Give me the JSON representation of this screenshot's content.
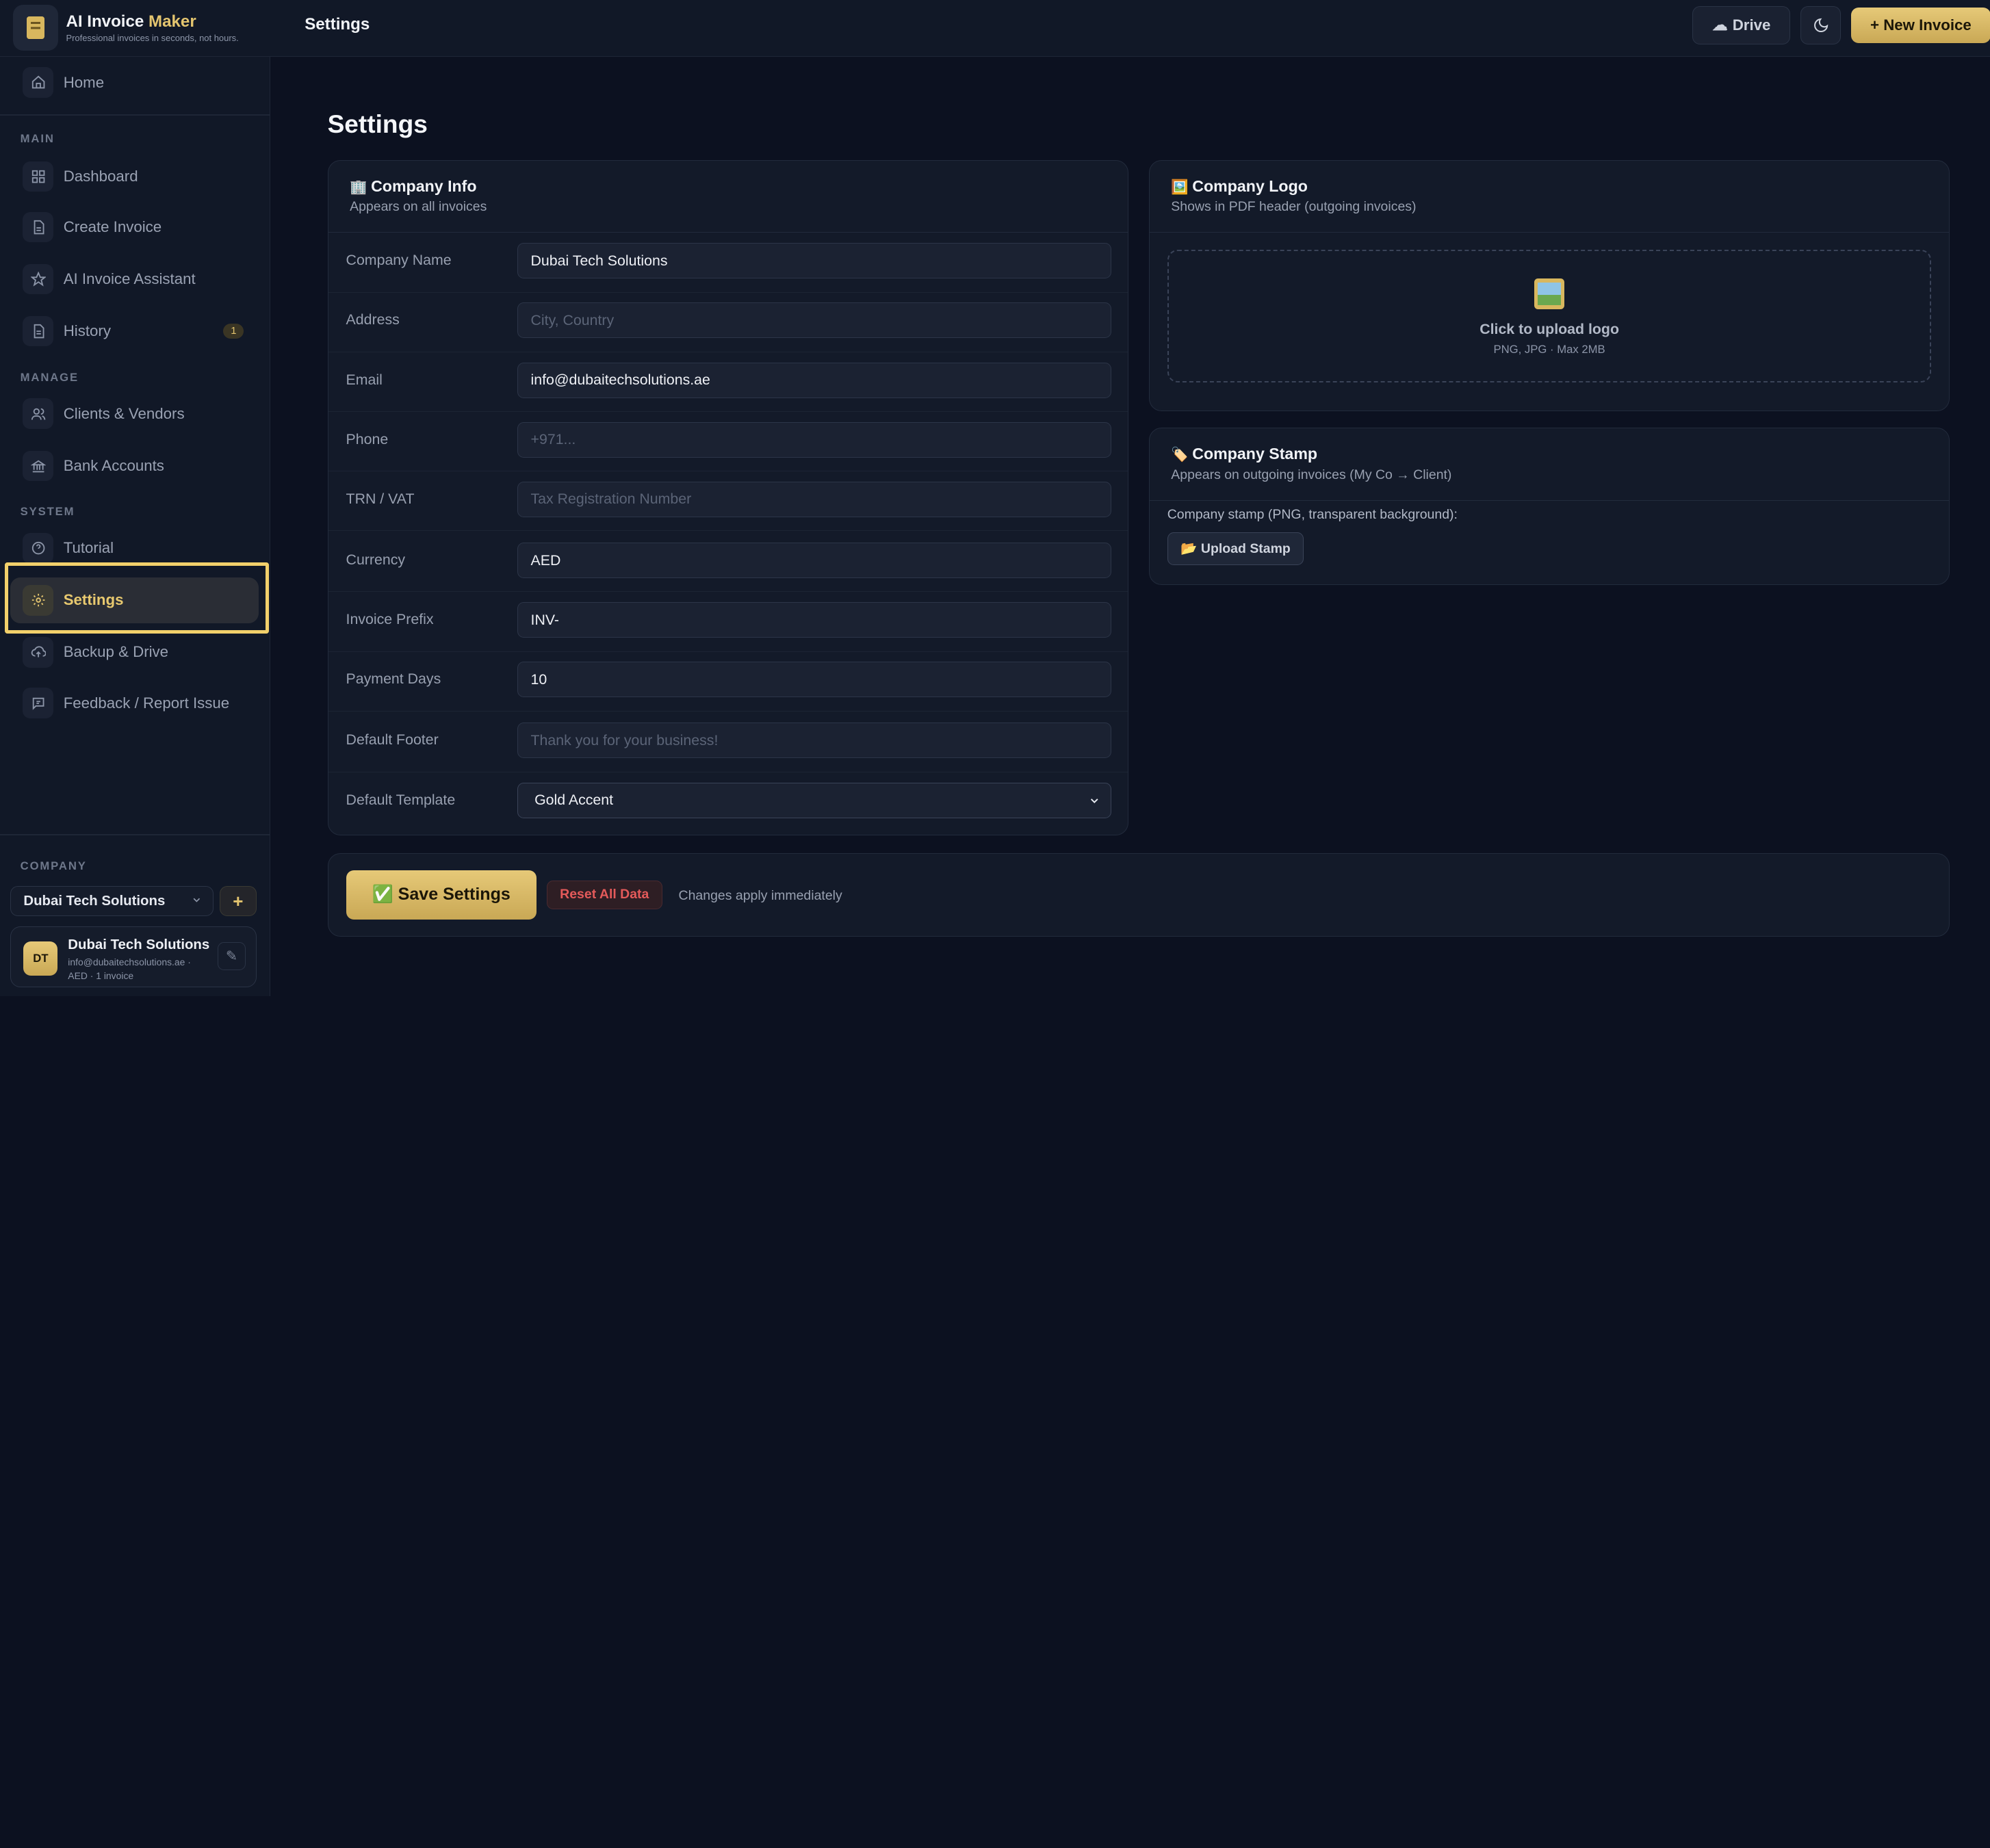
{
  "brand": {
    "title_main": "AI Invoice",
    "title_accent": "Maker",
    "tagline": "Professional invoices in seconds, not hours."
  },
  "topbar": {
    "page_title": "Settings",
    "drive_label": "Drive",
    "new_invoice_label": "+ New Invoice"
  },
  "sidebar": {
    "home": "Home",
    "sections": {
      "main": "MAIN",
      "manage": "MANAGE",
      "system": "SYSTEM",
      "company": "COMPANY"
    },
    "items": [
      {
        "label": "Dashboard",
        "icon": "grid-icon"
      },
      {
        "label": "Create Invoice",
        "icon": "document-icon"
      },
      {
        "label": "AI Invoice Assistant",
        "icon": "star-icon"
      },
      {
        "label": "History",
        "icon": "document-icon",
        "badge": "1"
      },
      {
        "label": "Clients & Vendors",
        "icon": "users-icon"
      },
      {
        "label": "Bank Accounts",
        "icon": "bank-icon"
      },
      {
        "label": "Tutorial",
        "icon": "help-icon"
      },
      {
        "label": "Settings",
        "icon": "gear-icon",
        "active": true
      },
      {
        "label": "Backup & Drive",
        "icon": "cloud-upload-icon"
      },
      {
        "label": "Feedback / Report Issue",
        "icon": "message-icon"
      }
    ],
    "company_select": "Dubai Tech Solutions",
    "company_add": "+",
    "company_card": {
      "initials": "DT",
      "name": "Dubai Tech Solutions",
      "email": "info@dubaitechsolutions.ae ·",
      "meta": "AED · 1 invoice",
      "edit": "✎"
    }
  },
  "main": {
    "title": "Settings",
    "company_info": {
      "title": "Company Info",
      "emoji": "🏢",
      "subtitle": "Appears on all invoices",
      "fields": [
        {
          "label": "Company Name",
          "value": "Dubai Tech Solutions",
          "placeholder": ""
        },
        {
          "label": "Address",
          "value": "",
          "placeholder": "City, Country"
        },
        {
          "label": "Email",
          "value": "info@dubaitechsolutions.ae",
          "placeholder": ""
        },
        {
          "label": "Phone",
          "value": "",
          "placeholder": "+971..."
        },
        {
          "label": "TRN / VAT",
          "value": "",
          "placeholder": "Tax Registration Number"
        },
        {
          "label": "Currency",
          "value": "AED",
          "placeholder": ""
        },
        {
          "label": "Invoice Prefix",
          "value": "INV-",
          "placeholder": ""
        },
        {
          "label": "Payment Days",
          "value": "10",
          "placeholder": ""
        },
        {
          "label": "Default Footer",
          "value": "",
          "placeholder": "Thank you for your business!"
        }
      ],
      "template_label": "Default Template",
      "template_value": "Gold Accent"
    },
    "logo": {
      "title": "Company Logo",
      "emoji": "🖼️",
      "subtitle": "Shows in PDF header (outgoing invoices)",
      "upload_title": "Click to upload logo",
      "upload_note": "PNG, JPG · Max 2MB"
    },
    "stamp": {
      "title": "Company Stamp",
      "emoji": "🏷️",
      "subtitle": "Appears on outgoing invoices (My Co → Client)",
      "label": "Company stamp (PNG, transparent background):",
      "button": "📂 Upload Stamp"
    },
    "actions": {
      "save": "✅ Save Settings",
      "reset": "Reset All Data",
      "note": "Changes apply immediately"
    }
  },
  "colors": {
    "background": "#0c1120",
    "panel": "#131a29",
    "accent_gold": "#e4c56f",
    "danger": "#e45a5a"
  }
}
